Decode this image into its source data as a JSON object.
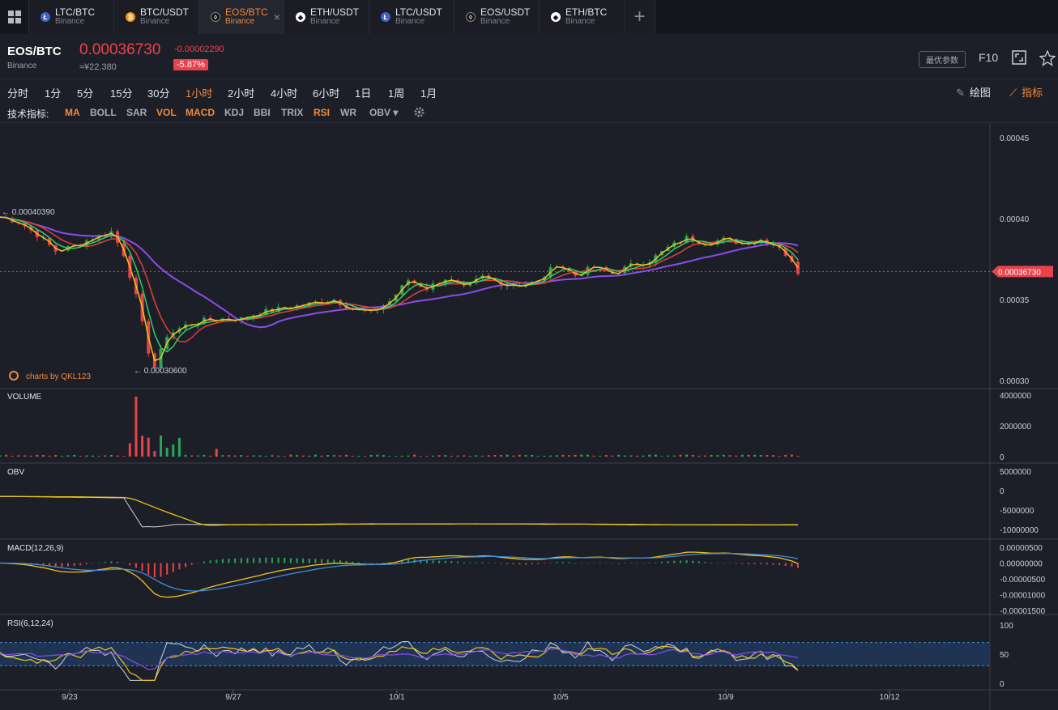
{
  "tabs": [
    {
      "pair": "LTC/BTC",
      "exchange": "Binance",
      "coin": "LTC",
      "color": "#3f62c6",
      "glyph": "Ł",
      "active": false
    },
    {
      "pair": "BTC/USDT",
      "exchange": "Binance",
      "coin": "BTC",
      "color": "#f39321",
      "glyph": "₿",
      "active": false
    },
    {
      "pair": "EOS/BTC",
      "exchange": "Binance",
      "coin": "EOS",
      "color": "#111111",
      "glyph": "◊",
      "active": true
    },
    {
      "pair": "ETH/USDT",
      "exchange": "Binance",
      "coin": "ETH",
      "color": "#ffffff",
      "glyph": "◆",
      "active": false
    },
    {
      "pair": "LTC/USDT",
      "exchange": "Binance",
      "coin": "LTC",
      "color": "#3f62c6",
      "glyph": "Ł",
      "active": false
    },
    {
      "pair": "EOS/USDT",
      "exchange": "Binance",
      "coin": "EOS",
      "color": "#111111",
      "glyph": "◊",
      "active": false
    },
    {
      "pair": "ETH/BTC",
      "exchange": "Binance",
      "coin": "ETH",
      "color": "#ffffff",
      "glyph": "◆",
      "active": false
    }
  ],
  "header": {
    "pair": "EOS/BTC",
    "exchange": "Binance",
    "price": "0.00036730",
    "cny": "≈¥22.380",
    "change": "-0.00002290",
    "change_pct": "-5.87%",
    "best_params": "最优参数",
    "f10": "F10"
  },
  "timeframes": [
    "分时",
    "1分",
    "5分",
    "15分",
    "30分",
    "1小时",
    "2小时",
    "4小时",
    "6小时",
    "1日",
    "1周",
    "1月"
  ],
  "active_timeframe": "1小时",
  "tools": {
    "draw": "绘图",
    "indicators": "指标"
  },
  "indicator_bar": {
    "label": "技术指标:",
    "items": [
      {
        "name": "MA",
        "on": true
      },
      {
        "name": "BOLL",
        "on": false
      },
      {
        "name": "SAR",
        "on": false
      },
      {
        "name": "VOL",
        "on": true
      },
      {
        "name": "MACD",
        "on": true
      },
      {
        "name": "KDJ",
        "on": false
      },
      {
        "name": "BBI",
        "on": false
      },
      {
        "name": "TRIX",
        "on": false
      },
      {
        "name": "RSI",
        "on": true
      },
      {
        "name": "WR",
        "on": false
      },
      {
        "name": "OBV ▾",
        "on": false
      }
    ]
  },
  "colors": {
    "up": "#26a65b",
    "down": "#e8424b",
    "ma_yellow": "#f0c419",
    "ma_green": "#2ecc71",
    "ma_red": "#e0413a",
    "ma_purple": "#8a4de8",
    "accent": "#f08a3c"
  },
  "chart_data": {
    "type": "line",
    "x_ticks": [
      "9/23",
      "9/27",
      "10/1",
      "10/5",
      "10/9",
      "10/12"
    ],
    "price_axis": [
      "0.00045",
      "0.00040",
      "0.00035",
      "0.00030"
    ],
    "price_range": [
      0.0003,
      0.00045
    ],
    "last_price_label": "0.00036730",
    "last_price": 0.0003673,
    "high_label": "← 0.00040390",
    "high": 0.0004039,
    "low_label": "← 0.00030600",
    "low": 0.000306,
    "watermark": "charts by QKL123",
    "price_series": [
      [
        0,
        0.000401
      ],
      [
        3,
        0.000398
      ],
      [
        6,
        0.00039
      ],
      [
        9,
        0.00038
      ],
      [
        12,
        0.000383
      ],
      [
        15,
        0.000388
      ],
      [
        18,
        0.000392
      ],
      [
        20,
        0.000378
      ],
      [
        22,
        0.000352
      ],
      [
        24,
        0.000318
      ],
      [
        25,
        0.000308
      ],
      [
        27,
        0.000328
      ],
      [
        30,
        0.000334
      ],
      [
        33,
        0.000337
      ],
      [
        36,
        0.000338
      ],
      [
        39,
        0.000338
      ],
      [
        42,
        0.000342
      ],
      [
        45,
        0.000344
      ],
      [
        48,
        0.000346
      ],
      [
        51,
        0.000348
      ],
      [
        54,
        0.00035
      ],
      [
        57,
        0.000344
      ],
      [
        60,
        0.000342
      ],
      [
        63,
        0.000349
      ],
      [
        66,
        0.000362
      ],
      [
        69,
        0.000357
      ],
      [
        72,
        0.000363
      ],
      [
        75,
        0.000357
      ],
      [
        78,
        0.000364
      ],
      [
        81,
        0.00036
      ],
      [
        84,
        0.000359
      ],
      [
        87,
        0.000361
      ],
      [
        90,
        0.000372
      ],
      [
        93,
        0.000365
      ],
      [
        96,
        0.00037
      ],
      [
        99,
        0.000366
      ],
      [
        102,
        0.000371
      ],
      [
        105,
        0.000374
      ],
      [
        108,
        0.000382
      ],
      [
        111,
        0.000388
      ],
      [
        114,
        0.000385
      ],
      [
        117,
        0.000387
      ],
      [
        120,
        0.000385
      ],
      [
        123,
        0.000387
      ],
      [
        126,
        0.000383
      ],
      [
        129,
        0.000367
      ]
    ],
    "volume": {
      "label": "VOLUME",
      "axis": [
        "4000000",
        "2000000",
        "0"
      ],
      "range": [
        0,
        4000000
      ]
    },
    "obv": {
      "label": "OBV",
      "axis": [
        "5000000",
        "0",
        "-5000000",
        "-10000000"
      ],
      "range": [
        -10000000,
        5000000
      ]
    },
    "macd": {
      "label": "MACD(12,26,9)",
      "axis": [
        "0.00000500",
        "0.00000000",
        "-0.00000500",
        "-0.00001000",
        "-0.00001500"
      ],
      "range": [
        -1.5e-05,
        5e-06
      ]
    },
    "rsi": {
      "label": "RSI(6,12,24)",
      "axis": [
        "100",
        "50",
        "0"
      ],
      "range": [
        0,
        100
      ],
      "bands": [
        30,
        70
      ]
    }
  }
}
